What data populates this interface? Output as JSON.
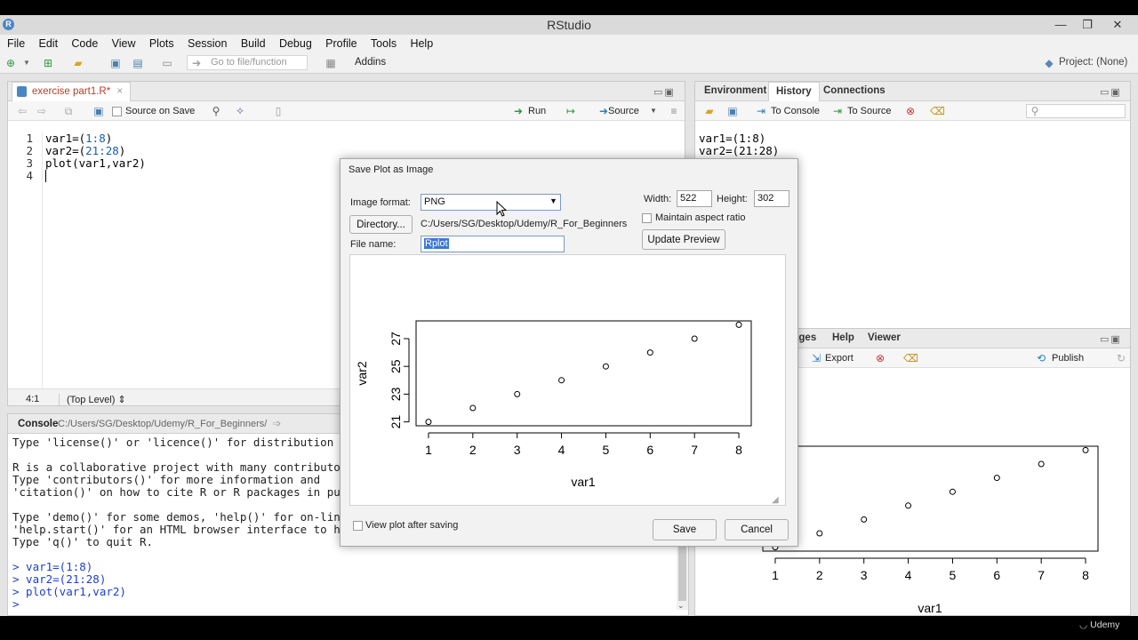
{
  "window": {
    "title": "RStudio",
    "min_icon": "—",
    "restore_icon": "❐",
    "close_icon": "✕"
  },
  "menu": [
    "File",
    "Edit",
    "Code",
    "View",
    "Plots",
    "Session",
    "Build",
    "Debug",
    "Profile",
    "Tools",
    "Help"
  ],
  "toolbar": {
    "goto_placeholder": "Go to file/function",
    "addins_label": "Addins",
    "project_label": "Project: (None)"
  },
  "editor": {
    "tab_label": "exercise part1.R*",
    "source_on_save_label": "Source on Save",
    "run_label": "Run",
    "source_label": "Source",
    "line_numbers": [
      "1",
      "2",
      "3",
      "4"
    ],
    "lines": [
      {
        "prefix": "var1=(",
        "num": "1:8",
        "suffix": ")"
      },
      {
        "prefix": "var2=(",
        "num": "21:28",
        "suffix": ")"
      },
      {
        "prefix": "plot(var1,var2)",
        "num": "",
        "suffix": ""
      },
      {
        "prefix": "",
        "num": "",
        "suffix": ""
      }
    ],
    "status_pos": "4:1",
    "status_level": "(Top Level) ⇕"
  },
  "console": {
    "tab_label": "Console",
    "path": "C:/Users/SG/Desktop/Udemy/R_For_Beginners/",
    "output_lines": [
      "Type 'license()' or 'licence()' for distribution",
      "",
      "R is a collaborative project with many contributo",
      "Type 'contributors()' for more information and",
      "'citation()' on how to cite R or R packages in pu",
      "",
      "Type 'demo()' for some demos, 'help()' for on-lin",
      "'help.start()' for an HTML browser interface to h",
      "Type 'q()' to quit R.",
      ""
    ],
    "prompt_lines": [
      "> var1=(1:8)",
      "> var2=(21:28)",
      "> plot(var1,var2)",
      "> "
    ]
  },
  "env": {
    "tabs": [
      "Environment",
      "History",
      "Connections"
    ],
    "active_tab": "History",
    "to_console_label": "To Console",
    "to_source_label": "To Source",
    "history": [
      "var1=(1:8)",
      "var2=(21:28)"
    ]
  },
  "plots_pane": {
    "tabs": [
      "ages",
      "Help",
      "Viewer"
    ],
    "export_label": "Export",
    "publish_label": "Publish"
  },
  "dialog": {
    "title": "Save Plot as Image",
    "image_format_label": "Image format:",
    "image_format_value": "PNG",
    "directory_button": "Directory...",
    "directory_path": "C:/Users/SG/Desktop/Udemy/R_For_Beginners",
    "file_name_label": "File name:",
    "file_name_value": "Rplot",
    "width_label": "Width:",
    "width_value": "522",
    "height_label": "Height:",
    "height_value": "302",
    "maintain_aspect_label": "Maintain aspect ratio",
    "update_preview_button": "Update Preview",
    "view_after_saving_label": "View plot after saving",
    "save_button": "Save",
    "cancel_button": "Cancel"
  },
  "watermark": "Udemy",
  "chart_data": [
    {
      "type": "scatter",
      "x": [
        1,
        2,
        3,
        4,
        5,
        6,
        7,
        8
      ],
      "y": [
        21,
        22,
        23,
        24,
        25,
        26,
        27,
        28
      ],
      "xlabel": "var1",
      "ylabel": "var2",
      "xticks": [
        1,
        2,
        3,
        4,
        5,
        6,
        7,
        8
      ],
      "yticks": [
        21,
        23,
        25,
        27
      ],
      "xlim": [
        0.72,
        8.28
      ],
      "ylim": [
        20.72,
        28.28
      ],
      "grid": false
    },
    {
      "type": "scatter",
      "x": [
        1,
        2,
        3,
        4,
        5,
        6,
        7,
        8
      ],
      "y": [
        21,
        22,
        23,
        24,
        25,
        26,
        27,
        28
      ],
      "xlabel": "var1",
      "xticks": [
        1,
        2,
        3,
        4,
        5,
        6,
        7,
        8
      ],
      "xlim": [
        0.72,
        8.28
      ],
      "ylim": [
        20.72,
        28.28
      ],
      "grid": false
    }
  ]
}
